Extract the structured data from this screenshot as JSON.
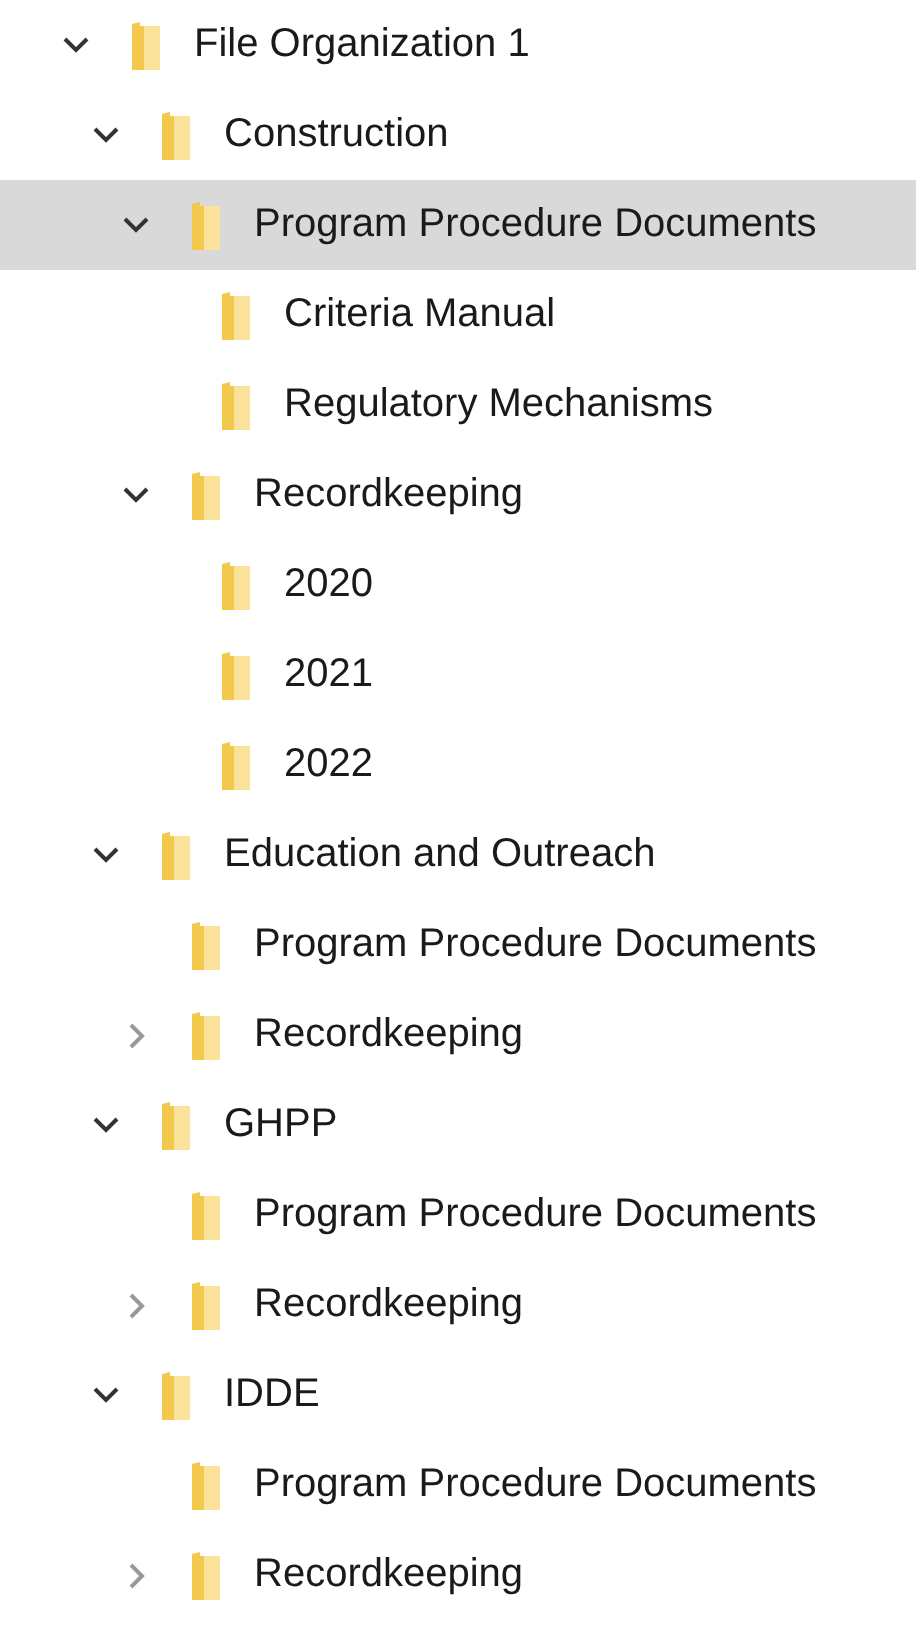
{
  "tree": [
    {
      "label": "File Organization 1",
      "expanded": true,
      "selected": false,
      "children": [
        {
          "label": "Construction",
          "expanded": true,
          "selected": false,
          "children": [
            {
              "label": "Program Procedure Documents",
              "expanded": true,
              "selected": true,
              "children": [
                {
                  "label": "Criteria Manual",
                  "selected": false
                },
                {
                  "label": "Regulatory Mechanisms",
                  "selected": false
                }
              ]
            },
            {
              "label": "Recordkeeping",
              "expanded": true,
              "selected": false,
              "children": [
                {
                  "label": "2020",
                  "selected": false
                },
                {
                  "label": "2021",
                  "selected": false
                },
                {
                  "label": "2022",
                  "selected": false
                }
              ]
            }
          ]
        },
        {
          "label": "Education and Outreach",
          "expanded": true,
          "selected": false,
          "children": [
            {
              "label": "Program Procedure Documents",
              "selected": false
            },
            {
              "label": "Recordkeeping",
              "expanded": false,
              "selected": false
            }
          ]
        },
        {
          "label": "GHPP",
          "expanded": true,
          "selected": false,
          "children": [
            {
              "label": "Program Procedure Documents",
              "selected": false
            },
            {
              "label": "Recordkeeping",
              "expanded": false,
              "selected": false
            }
          ]
        },
        {
          "label": "IDDE",
          "expanded": true,
          "selected": false,
          "children": [
            {
              "label": "Program Procedure Documents",
              "selected": false
            },
            {
              "label": "Recordkeeping",
              "expanded": false,
              "selected": false
            }
          ]
        }
      ]
    }
  ]
}
